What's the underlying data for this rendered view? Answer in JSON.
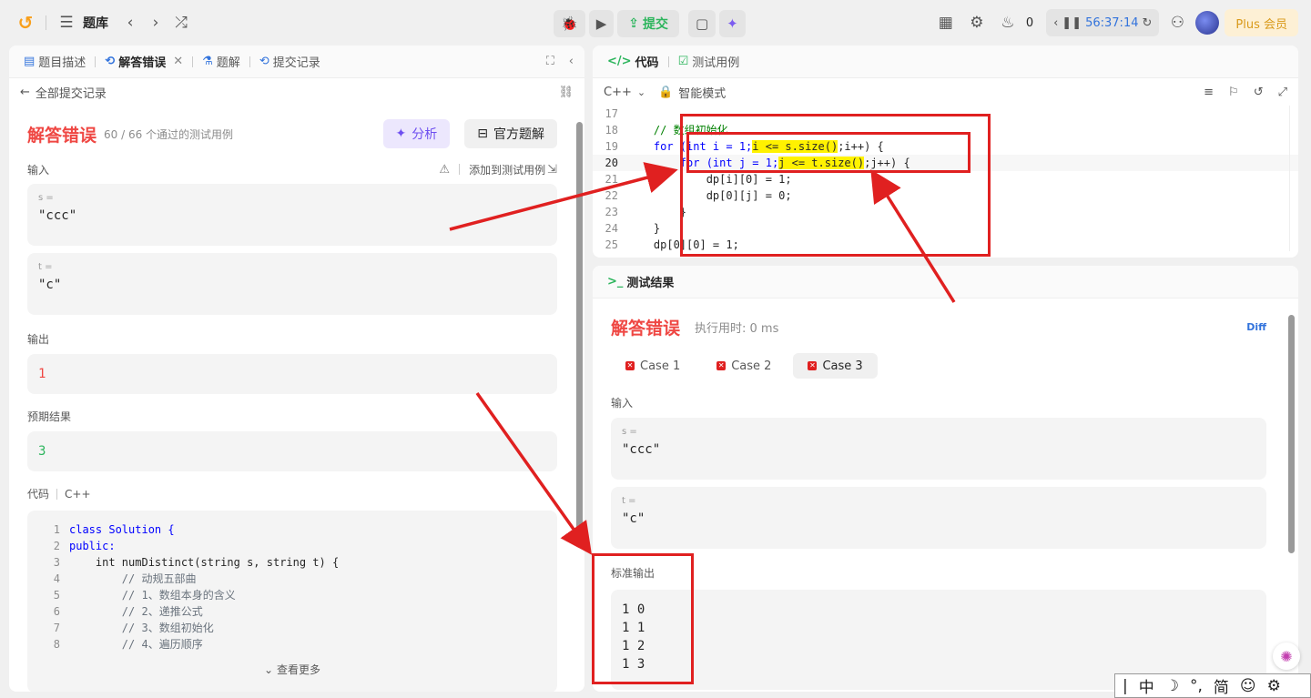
{
  "topbar": {
    "title": "题库",
    "submit_label": "提交",
    "fire_count": "0",
    "timer": "56:37:14",
    "plus_label": "Plus 会员"
  },
  "left": {
    "tabs": [
      "题目描述",
      "解答错误",
      "题解",
      "提交记录"
    ],
    "back_label": "全部提交记录",
    "status_title": "解答错误",
    "status_detail": "60 / 66 个通过的测试用例",
    "analyze_label": "分析",
    "official_label": "官方题解",
    "input_label": "输入",
    "add_testcase_label": "添加到测试用例",
    "inputs": [
      {
        "name": "s =",
        "value": "\"ccc\""
      },
      {
        "name": "t =",
        "value": "\"c\""
      }
    ],
    "output_label": "输出",
    "output_value": "1",
    "expected_label": "预期结果",
    "expected_value": "3",
    "code_label": "代码",
    "code_lang": "C++",
    "code_lines": [
      {
        "n": "1",
        "text": "class Solution {"
      },
      {
        "n": "2",
        "text": "public:"
      },
      {
        "n": "3",
        "text": "    int numDistinct(string s, string t) {"
      },
      {
        "n": "4",
        "text": "        // 动规五部曲"
      },
      {
        "n": "5",
        "text": "        // 1、数组本身的含义"
      },
      {
        "n": "6",
        "text": "        // 2、递推公式"
      },
      {
        "n": "7",
        "text": "        // 3、数组初始化"
      },
      {
        "n": "8",
        "text": "        // 4、遍历顺序"
      }
    ],
    "see_more_label": "查看更多"
  },
  "editor": {
    "tab_code": "代码",
    "tab_testcase": "测试用例",
    "lang": "C++",
    "mode": "智能模式",
    "lines": [
      {
        "n": "17",
        "text": ""
      },
      {
        "n": "18",
        "text": "    // 数组初始化"
      },
      {
        "n": "19",
        "a": "    for (int i = 1;",
        "h": "i <= s.size()",
        "b": ";i++) {"
      },
      {
        "n": "20",
        "a": "        for (int j = 1;",
        "h": "j <= t.size()",
        "b": ";j++) {"
      },
      {
        "n": "21",
        "text": "            dp[i][0] = 1;"
      },
      {
        "n": "22",
        "text": "            dp[0][j] = 0;"
      },
      {
        "n": "23",
        "text": "        }"
      },
      {
        "n": "24",
        "text": "    }"
      },
      {
        "n": "25",
        "text": "    dp[0][0] = 1;"
      }
    ]
  },
  "result": {
    "header": "测试结果",
    "status_title": "解答错误",
    "runtime": "执行用时: 0 ms",
    "diff_label": "Diff",
    "cases": [
      "Case 1",
      "Case 2",
      "Case 3"
    ],
    "input_label": "输入",
    "inputs": [
      {
        "name": "s =",
        "value": "\"ccc\""
      },
      {
        "name": "t =",
        "value": "\"c\""
      }
    ],
    "stdout_label": "标准输出",
    "stdout_lines": [
      "1 0",
      "1 1",
      "1 2",
      "1 3"
    ]
  },
  "ime": {
    "mode": "中",
    "width": "简"
  }
}
